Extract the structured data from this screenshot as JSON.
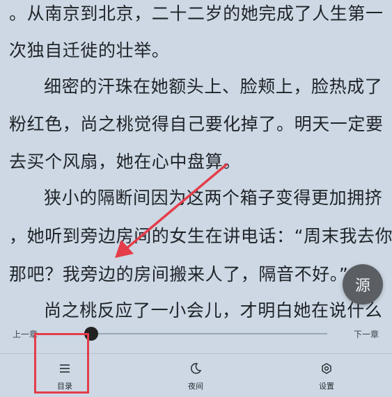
{
  "reader": {
    "lines": [
      "。从南京到北京，二十二岁的她完成了人生第一",
      "次独自迁徙的壮举。",
      "细密的汗珠在她额头上、脸颊上，脸热成了",
      "粉红色，尚之桃觉得自己要化掉了。明天一定要",
      "去买个风扇，她在心中盘算。",
      "狭小的隔断间因为这两个箱子变得更加拥挤",
      "，她听到旁边房间的女生在讲电话：“周末我去你",
      "那吧？我旁边的房间搬来人了，隔音不好。”",
      "尚之桃反应了一小会儿，才明白她在说什么"
    ]
  },
  "source_button": {
    "label": "源"
  },
  "progress": {
    "prev_label": "上一章",
    "next_label": "下一章",
    "value_fraction": 0.1
  },
  "toolbar": {
    "catalog_label": "目录",
    "catalog_icon": "list-icon",
    "night_label": "夜间",
    "night_icon": "moon-icon",
    "settings_label": "设置",
    "settings_icon": "gear-icon"
  },
  "annotation": {
    "highlight_color": "#e53d4a",
    "arrow_color": "#e53d4a"
  }
}
